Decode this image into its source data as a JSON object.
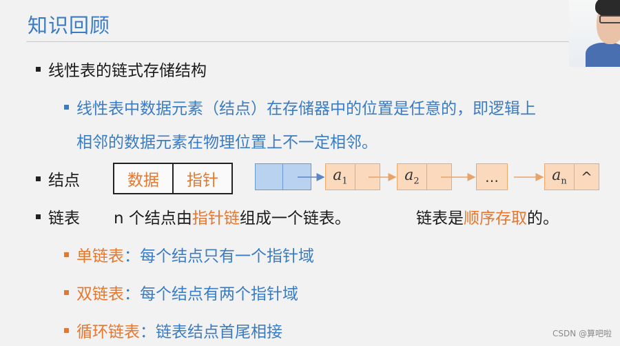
{
  "header": {
    "title": "知识回顾"
  },
  "section1": {
    "heading": "线性表的链式存储结构",
    "sub_line1": "线性表中数据元素（结点）在存储器中的位置是任意的，即逻辑上",
    "sub_line2": "相邻的数据元素在物理位置上不一定相邻。"
  },
  "node_section": {
    "label": "结点",
    "field_data": "数据",
    "field_pointer": "指针",
    "list_nodes": [
      {
        "label": "a",
        "sub": "1"
      },
      {
        "label": "a",
        "sub": "2"
      },
      {
        "label": "…",
        "sub": ""
      },
      {
        "label": "a",
        "sub": "n"
      }
    ],
    "null_symbol": "^"
  },
  "linked_list": {
    "label": "链表",
    "desc_pre": "n 个结点由",
    "desc_emph": "指针链",
    "desc_post": "组成一个链表。",
    "desc2_pre": "链表是",
    "desc2_emph": "顺序存取",
    "desc2_post": "的。"
  },
  "types": [
    {
      "name": "单链表",
      "desc": "：每个结点只有一个指针域"
    },
    {
      "name": "双链表",
      "desc": "：每个结点有两个指针域"
    },
    {
      "name": "循环链表",
      "desc": "：链表结点首尾相接"
    }
  ],
  "watermark": "CSDN @算吧啦",
  "colors": {
    "accent_blue": "#3a7cc4",
    "accent_orange": "#e8772e"
  }
}
